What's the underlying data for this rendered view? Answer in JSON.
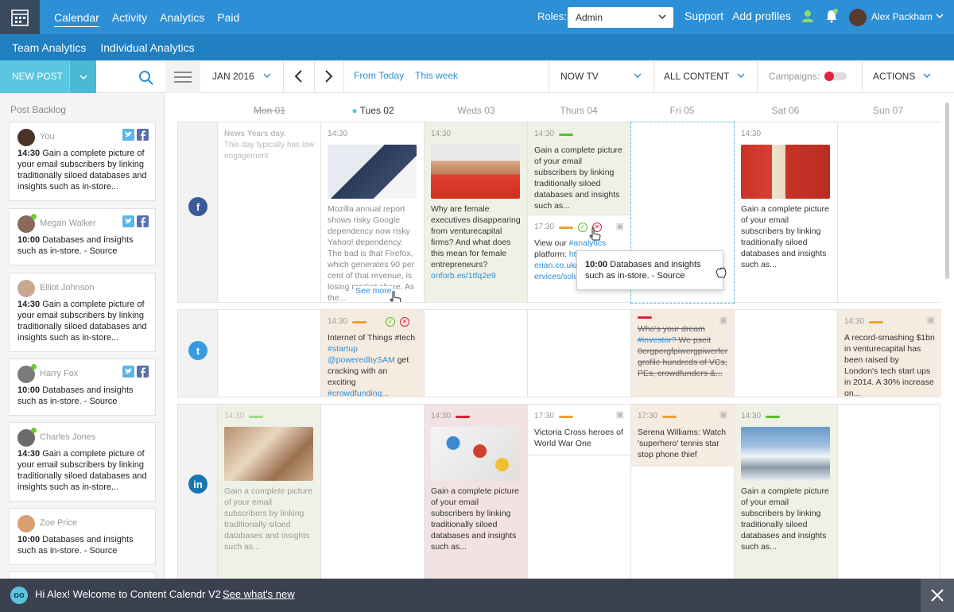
{
  "topbar": {
    "nav": [
      "Calendar",
      "Activity",
      "Analytics",
      "Paid"
    ],
    "roles_label": "Roles:",
    "roles_value": "Admin",
    "support": "Support",
    "add_profiles": "Add profiles",
    "user_name": "Alex Packham"
  },
  "subnav": [
    "Team Analytics",
    "Individual Analytics"
  ],
  "toolbar": {
    "new_post": "NEW POST",
    "month": "JAN 2016",
    "from_today": "From Today",
    "this_week": "This week",
    "channel": "NOW TV",
    "content": "ALL CONTENT",
    "campaigns": "Campaigns:",
    "actions": "ACTIONS"
  },
  "sidebar": {
    "title": "Post Backlog",
    "cards": [
      {
        "name": "You",
        "time": "14:30",
        "text": "Gain a complete picture of your email subscribers by linking traditionally siloed databases and insights such as in-store..."
      },
      {
        "name": "Megan Walker",
        "time": "10:00",
        "text": "Databases and insights such as in-store. - Source"
      },
      {
        "name": "Elliot Johnson",
        "time": "14:30",
        "text": "Gain a complete picture of your email subscribers by linking traditionally siloed databases and insights such as in-store..."
      },
      {
        "name": "Harry Fox",
        "time": "10:00",
        "text": "Databases and insights such as in-store. - Source"
      },
      {
        "name": "Charles Jones",
        "time": "14:30",
        "text": "Gain a complete picture of your email subscribers by linking traditionally siloed databases and insights such as in-store..."
      },
      {
        "name": "Zoe Price",
        "time": "10:00",
        "text": "Databases and insights such as in-store. - Source"
      }
    ]
  },
  "days": [
    "Mon 01",
    "Tues 02",
    "Weds 03",
    "Thurs 04",
    "Fri 05",
    "Sat 06",
    "Sun 07"
  ],
  "facebook": {
    "mon_title": "News Years day.",
    "mon_sub": "This day typically has low engagement",
    "tue_time": "14:30",
    "tue_text": "Mozilla annual report shows risky Google dependency now risky Yahoo! dependency. The bad is that Firefox, which generates 90 per cent of that revenue, is losing market share. As the...",
    "tue_more": "See more",
    "wed_time": "14:30",
    "wed_text": "Why are female executives disappearing from venturecapital firms? And what does this mean for female entrepreneurs?",
    "wed_link": "onforb.es/1tfq2e9",
    "thu_time1": "14:30",
    "thu_text1": "Gain a complete picture of your email subscribers by linking traditionally siloed databases and insights such as...",
    "thu_time2": "17:30",
    "thu_text2a": "View our",
    "thu_text2b": "#analytics",
    "thu_text2c": "platform:",
    "thu_text2d": "http://www.experian.co.uk/marketing-services/solutions/in...",
    "sat_time": "14:30",
    "sat_text": "Gain a complete picture of your email subscribers by linking traditionally siloed databases and insights such as...",
    "tooltip_time": "10:00",
    "tooltip_text": "Databases and insights such as in-store. - Source"
  },
  "twitter": {
    "tue_time": "14:30",
    "tue_a": "Internet of Things #tech",
    "tue_b": "#startup",
    "tue_c": "@poweredbySAM",
    "tue_d": "get cracking with an exciting",
    "tue_e": "#crowdfunding...",
    "fri_a": "Who's your dream",
    "fri_b": "#investor?",
    "fri_c": "We pseit 0ergpergfpiwergpiwerfer grofile hundreds of VCs, PEs, crowdfunders &...",
    "sun_time": "14:30",
    "sun_text": "A record-smashing $1bn in venturecapital has been raised by London's tech start ups in 2014. A 30% increase on..."
  },
  "linkedin": {
    "mon_time": "14:30",
    "mon_text": "Gain a complete picture of your email subscribers by linking traditionally siloed databases and insights such as...",
    "wed_time": "14:30",
    "wed_text": "Gain a complete picture of your email subscribers by linking traditionally siloed databases and insights such as...",
    "thu_time": "17:30",
    "thu_text": "Victoria Cross heroes of World War One",
    "fri_time": "17:30",
    "fri_text": "Serena Williams: Watch 'superhero' tennis star stop phone thief",
    "sat_time": "14:30",
    "sat_text": "Gain a complete picture of your email subscribers by linking traditionally siloed databases and insights such as..."
  },
  "footer": {
    "message": "Hi Alex! Welcome to Content Calendr V2",
    "link": "See what's new"
  },
  "colors": {
    "brand": "#2d8fd5",
    "accent": "#5bc6e0",
    "green": "#5bbf2a",
    "orange": "#f0a030",
    "red": "#d9213a"
  }
}
